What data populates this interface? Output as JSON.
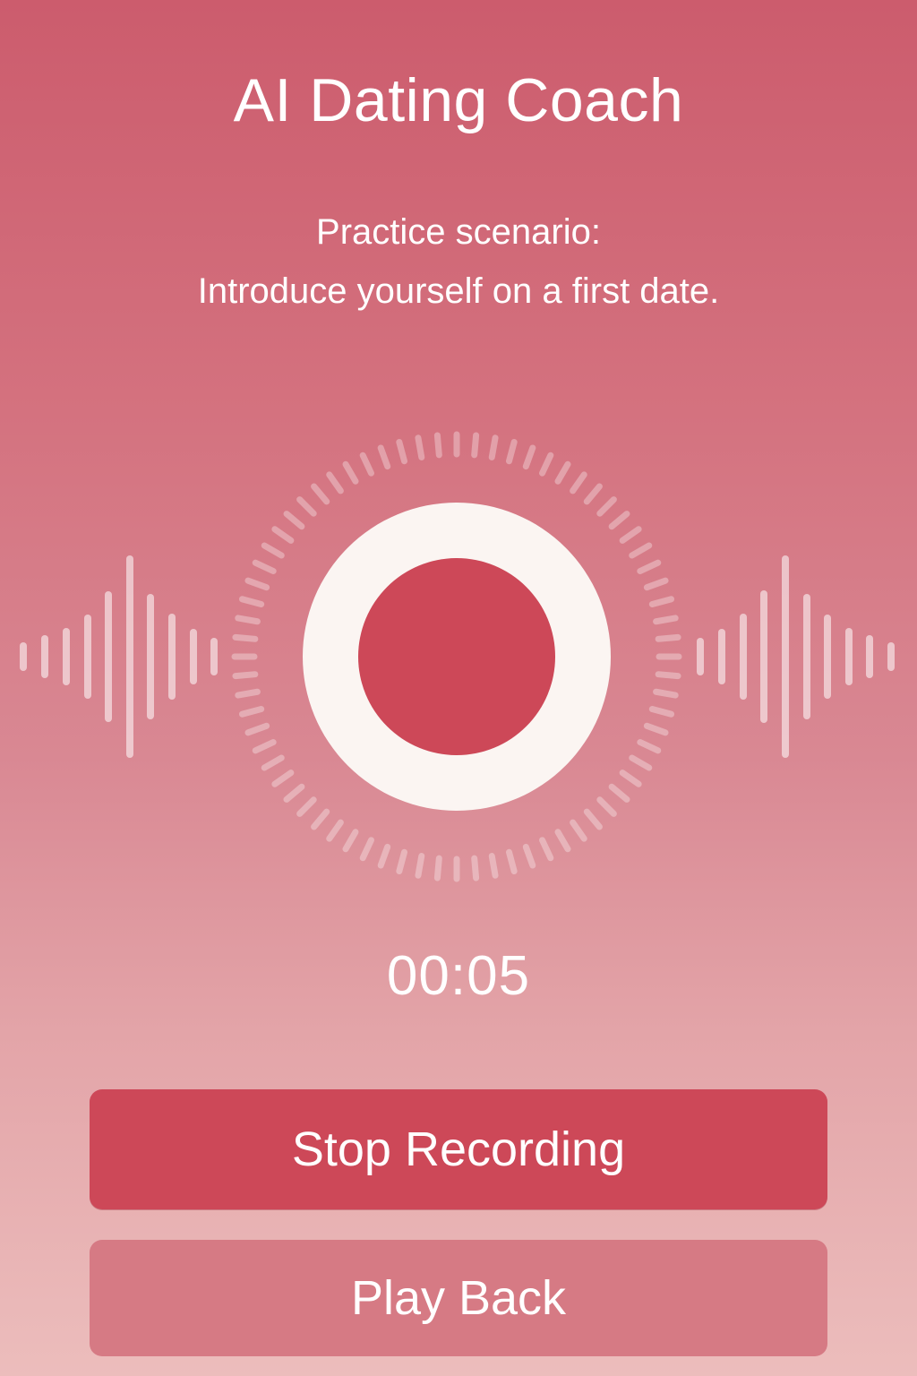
{
  "header": {
    "title": "AI Dating Coach"
  },
  "scenario": {
    "line1": "Practice scenario:",
    "line2": "Introduce yourself on a first date."
  },
  "recorder": {
    "state": "recording",
    "icon": "record-icon",
    "timer": "00:05"
  },
  "actions": {
    "stop_label": "Stop Recording",
    "play_label": "Play Back"
  },
  "colors": {
    "accent": "#cd4858",
    "secondary_button": "#d67a84",
    "record_ring": "#fbf5f2",
    "text": "#ffffff"
  }
}
